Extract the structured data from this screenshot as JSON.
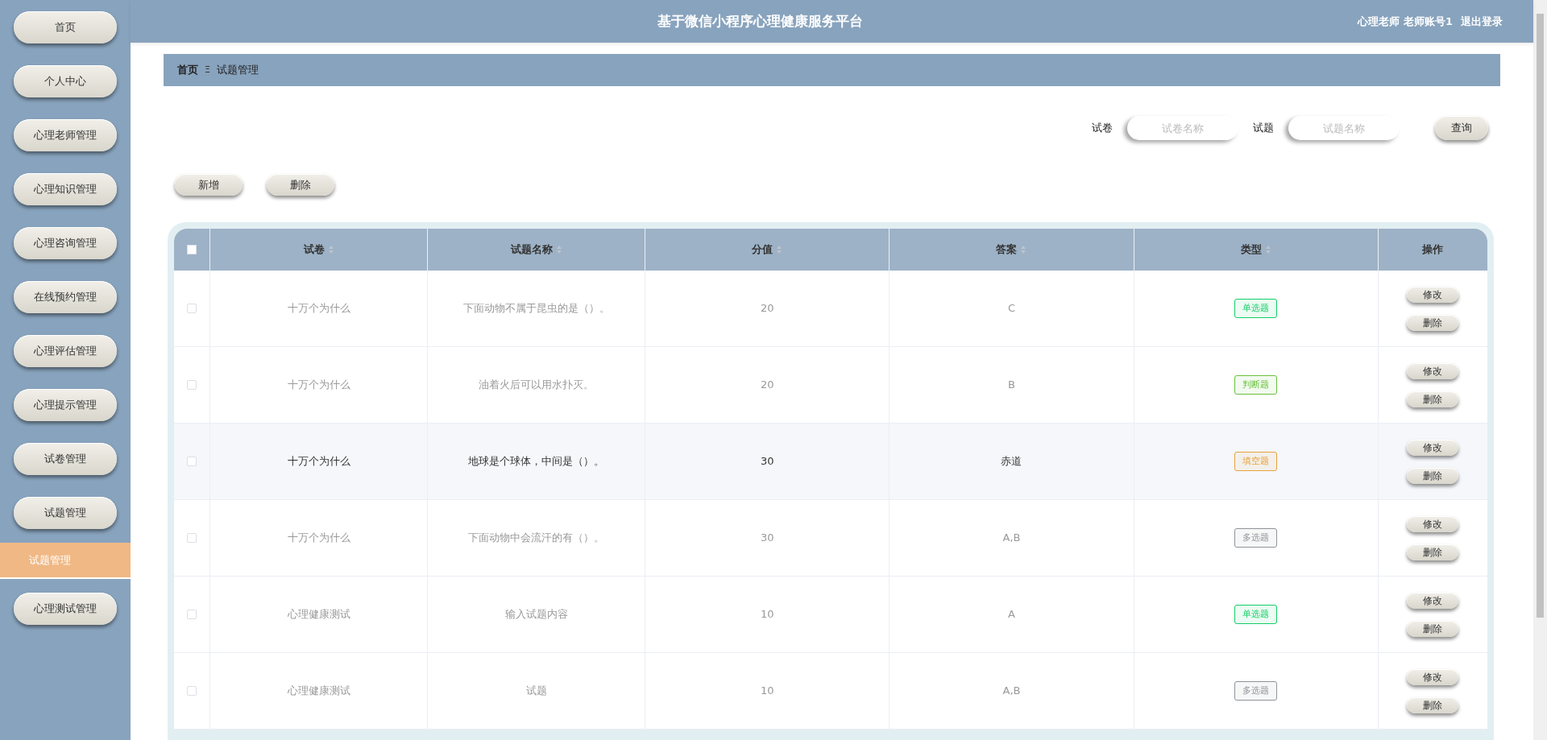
{
  "sidebar": {
    "items": [
      {
        "label": "首页",
        "selected": false
      },
      {
        "label": "个人中心",
        "selected": false
      },
      {
        "label": "心理老师管理",
        "selected": false
      },
      {
        "label": "心理知识管理",
        "selected": false
      },
      {
        "label": "心理咨询管理",
        "selected": false
      },
      {
        "label": "在线预约管理",
        "selected": false
      },
      {
        "label": "心理评估管理",
        "selected": false
      },
      {
        "label": "心理提示管理",
        "selected": false
      },
      {
        "label": "试卷管理",
        "selected": false
      },
      {
        "label": "试题管理",
        "selected": false
      },
      {
        "label": "试题管理",
        "selected": true
      },
      {
        "label": "心理测试管理",
        "selected": false
      }
    ]
  },
  "header": {
    "title": "基于微信小程序心理健康服务平台",
    "user": "心理老师 老师账号1",
    "logout": "退出登录"
  },
  "breadcrumb": [
    "首页",
    "试题管理"
  ],
  "breadcrumb_separator": "Ξ",
  "search": {
    "fields": [
      {
        "label": "试卷",
        "placeholder": "试卷名称"
      },
      {
        "label": "试题",
        "placeholder": "试题名称"
      }
    ],
    "button": "查询"
  },
  "actions": [
    "新增",
    "删除"
  ],
  "table": {
    "columns": [
      {
        "label": "试卷",
        "sortable": true
      },
      {
        "label": "试题名称",
        "sortable": true
      },
      {
        "label": "分值",
        "sortable": true
      },
      {
        "label": "答案",
        "sortable": true
      },
      {
        "label": "类型",
        "sortable": true
      },
      {
        "label": "操作",
        "sortable": false
      }
    ],
    "select_all_checked": false,
    "rows": [
      {
        "paper": "十万个为什么",
        "question": "下面动物不属于昆虫的是（）。",
        "score": "20",
        "answer": "C",
        "type": "单选题",
        "color": "#13ce66",
        "checked": false,
        "highlighted": false,
        "edit": "修改",
        "delete": "删除"
      },
      {
        "paper": "十万个为什么",
        "question": "油着火后可以用水扑灭。",
        "score": "20",
        "answer": "B",
        "type": "判断题",
        "color": "#67c23a",
        "checked": false,
        "highlighted": false,
        "edit": "修改",
        "delete": "删除"
      },
      {
        "paper": "十万个为什么",
        "question": "地球是个球体，中间是（）。",
        "score": "30",
        "answer": "赤道",
        "type": "填空题",
        "color": "#e6a23c",
        "checked": false,
        "highlighted": true,
        "edit": "修改",
        "delete": "删除"
      },
      {
        "paper": "十万个为什么",
        "question": "下面动物中会流汗的有（）。",
        "score": "30",
        "answer": "A,B",
        "type": "多选题",
        "color": "#909399",
        "checked": false,
        "highlighted": false,
        "edit": "修改",
        "delete": "删除"
      },
      {
        "paper": "心理健康测试",
        "question": "输入试题内容",
        "score": "10",
        "answer": "A",
        "type": "单选题",
        "color": "#13ce66",
        "checked": false,
        "highlighted": false,
        "edit": "修改",
        "delete": "删除"
      },
      {
        "paper": "心理健康测试",
        "question": "试题",
        "score": "10",
        "answer": "A,B",
        "type": "多选题",
        "color": "#909399",
        "checked": false,
        "highlighted": false,
        "edit": "修改",
        "delete": "删除"
      }
    ]
  }
}
